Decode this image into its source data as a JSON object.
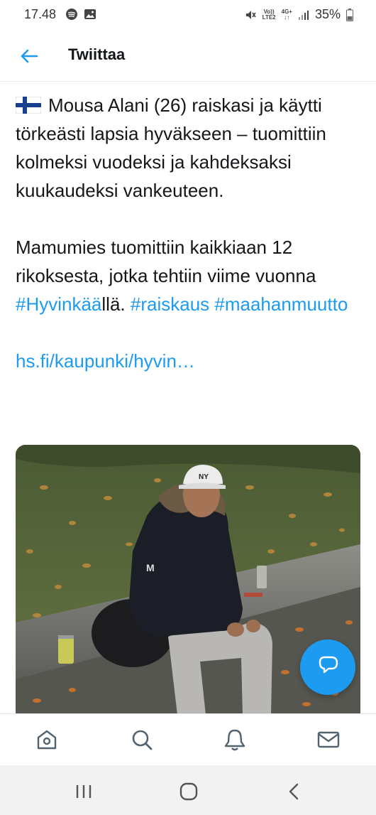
{
  "status_bar": {
    "time": "17.48",
    "battery": "35%",
    "network": [
      "Vo))",
      "LTE2",
      "4G+"
    ],
    "left_icons": [
      "spotify-icon",
      "image-icon"
    ],
    "right_icons": [
      "mute-icon",
      "signal-icon",
      "battery-icon"
    ]
  },
  "header": {
    "title": "Twiittaa",
    "back_icon": "arrow-left-icon"
  },
  "tweet": {
    "flag": "finland-flag",
    "paragraph1": "Mousa Alani (26) raiskasi ja käytti törkeästi lapsia hyväkseen – tuomittiin kolmeksi vuodeksi ja kahdeksaksi kuukaudeksi vankeuteen.",
    "p2_text1": "Mamumies tuomittiin kaikkiaan 12 rikoksesta, jotka tehtiin viime vuonna ",
    "hashtag1": "#Hyvinkää",
    "p2_text2": "llä. ",
    "hashtag2": "#raiskaus",
    "hashtag3": "#maahanmuutto",
    "url": "hs.fi/kaupunki/hyvin…"
  },
  "photo": {
    "cap_text": "NY",
    "jacket_logo": "M"
  },
  "fab": {
    "icon": "compose-reply-icon"
  },
  "tabbar": [
    "home-icon",
    "search-icon",
    "bell-icon",
    "mail-icon"
  ],
  "navbar": [
    "recent-apps-icon",
    "home-circle-icon",
    "back-chevron-icon"
  ],
  "colors": {
    "link": "#1d9bf0",
    "text": "#14171a",
    "fab": "#1d9bf0"
  }
}
